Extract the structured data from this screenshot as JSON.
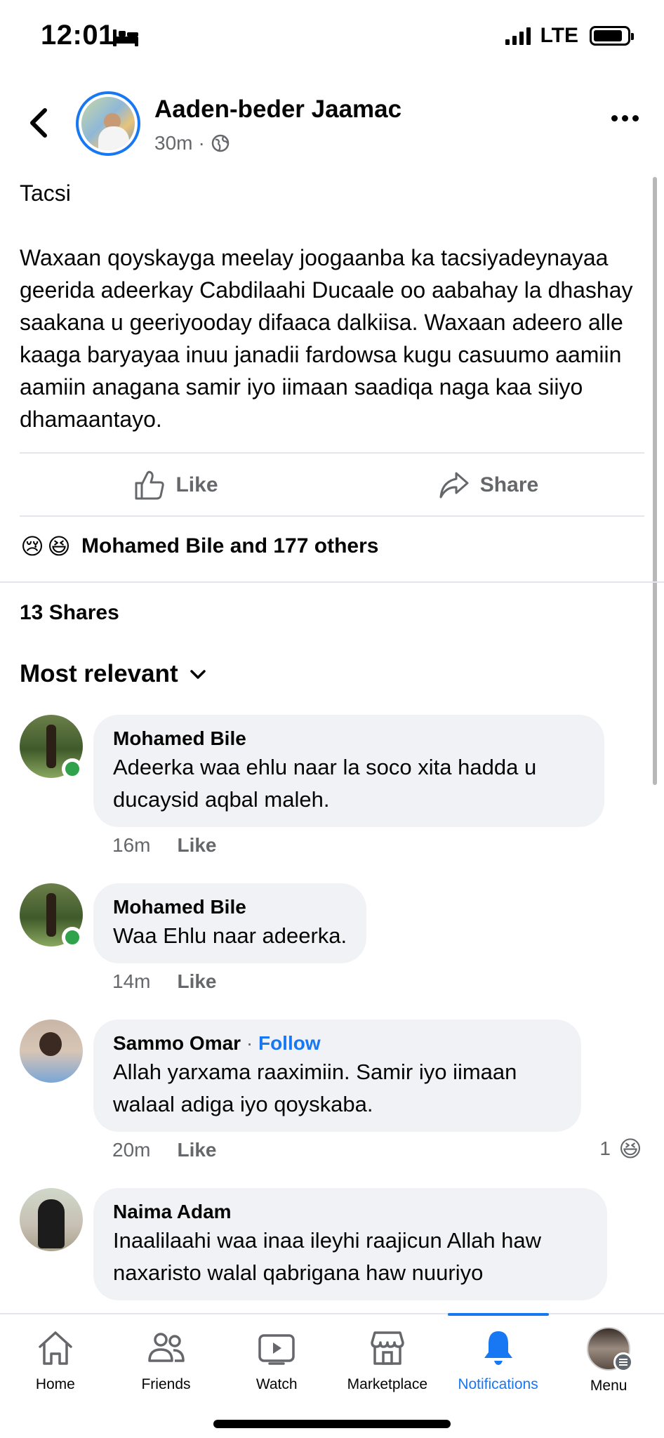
{
  "status_bar": {
    "time": "12:01",
    "network": "LTE"
  },
  "post": {
    "author": "Aaden-beder Jaamac",
    "time_ago": "30m",
    "meta_separator": "·",
    "paragraphs": [
      "Tacsi",
      "Waxaan qoyskayga meelay joogaanba ka tacsiyadeynayaa geerida adeerkay Cabdilaahi Ducaale oo aabahay la dhashay saakana u geeriyooday difaaca dalkiisa. Waxaan adeero alle kaaga baryayaa inuu janadii fardowsa kugu casuumo aamiin aamiin anagana samir iyo iimaan saadiqa naga kaa siiyo dhamaantayo."
    ],
    "actions": {
      "like": "Like",
      "share": "Share"
    },
    "reactions": {
      "emojis": [
        "😢",
        "😆"
      ],
      "summary": "Mohamed Bile and 177 others"
    },
    "shares_count": "13 Shares"
  },
  "comments_section": {
    "sort_label": "Most relevant",
    "comments": [
      {
        "name": "Mohamed Bile",
        "text": "Adeerka waa ehlu naar la soco xita hadda u ducaysid aqbal maleh.",
        "time": "16m",
        "like": "Like"
      },
      {
        "name": "Mohamed Bile",
        "text": "Waa Ehlu naar adeerka.",
        "time": "14m",
        "like": "Like"
      },
      {
        "name": "Sammo Omar",
        "follow": "Follow",
        "separator": "·",
        "text": "Allah yarxama raaximiin. Samir iyo iimaan walaal adiga iyo qoyskaba.",
        "time": "20m",
        "like": "Like",
        "reaction_count": "1",
        "reaction_emoji": "😆"
      },
      {
        "name": "Naima Adam",
        "text": "Inaalilaahi waa inaa ileyhi raajicun Allah haw naxaristo walal qabrigana haw nuuriyo"
      }
    ]
  },
  "bottom_nav": {
    "items": [
      {
        "label": "Home",
        "icon": "home-icon"
      },
      {
        "label": "Friends",
        "icon": "friends-icon"
      },
      {
        "label": "Watch",
        "icon": "watch-icon"
      },
      {
        "label": "Marketplace",
        "icon": "marketplace-icon"
      },
      {
        "label": "Notifications",
        "icon": "bell-icon",
        "active": true
      },
      {
        "label": "Menu",
        "icon": "avatar"
      }
    ]
  },
  "colors": {
    "accent": "#1877f2",
    "muted": "#65676b",
    "bubble": "#f0f2f5",
    "online": "#31a24c"
  }
}
